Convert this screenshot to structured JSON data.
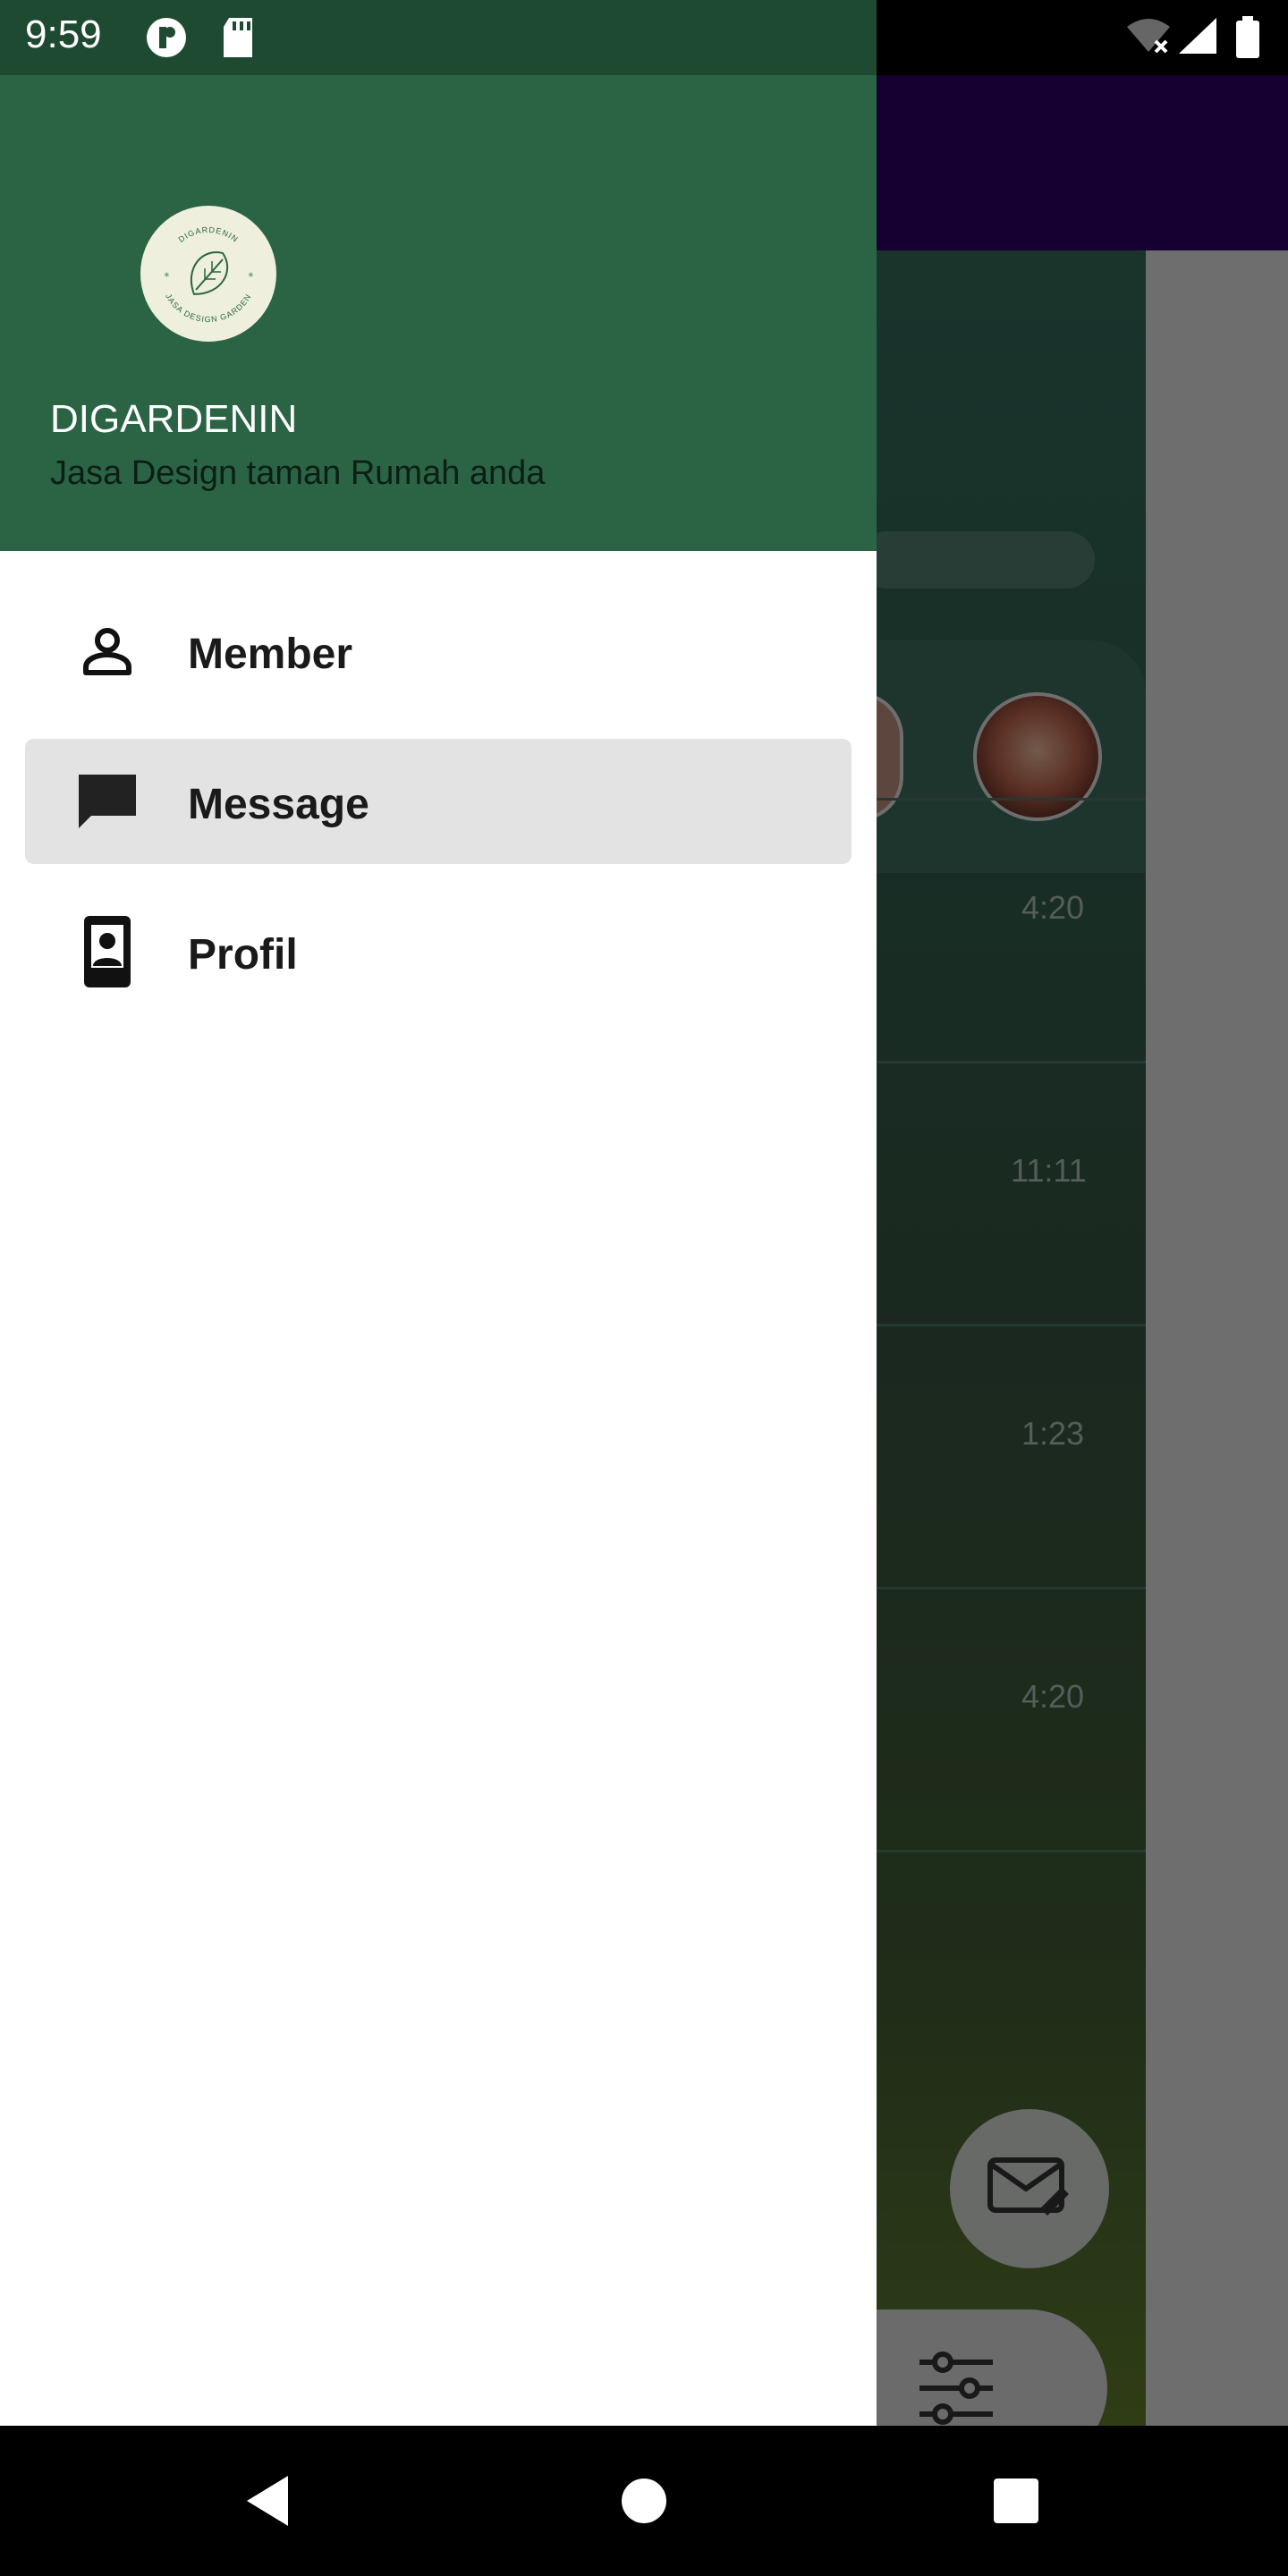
{
  "status_bar": {
    "time": "9:59"
  },
  "background_app": {
    "toolbar_title_fragment": "r",
    "times": [
      "4:20",
      "11:11",
      "1:23",
      "4:20"
    ]
  },
  "drawer": {
    "header": {
      "logo_text": "DIGARDENIN",
      "logo_subtext": "JASA DESIGN GARDEN",
      "brand": "DIGARDENIN",
      "tagline": "Jasa Design taman Rumah anda"
    },
    "menu": [
      {
        "label": "Member",
        "icon": "person-icon",
        "active": false
      },
      {
        "label": "Message",
        "icon": "chat-icon",
        "active": true
      },
      {
        "label": "Profil",
        "icon": "contact-card-icon",
        "active": false
      }
    ]
  },
  "colors": {
    "header_green": "#2b6444",
    "toolbar_purple": "#2a0062",
    "active_item_bg": "#e3e3e3"
  }
}
